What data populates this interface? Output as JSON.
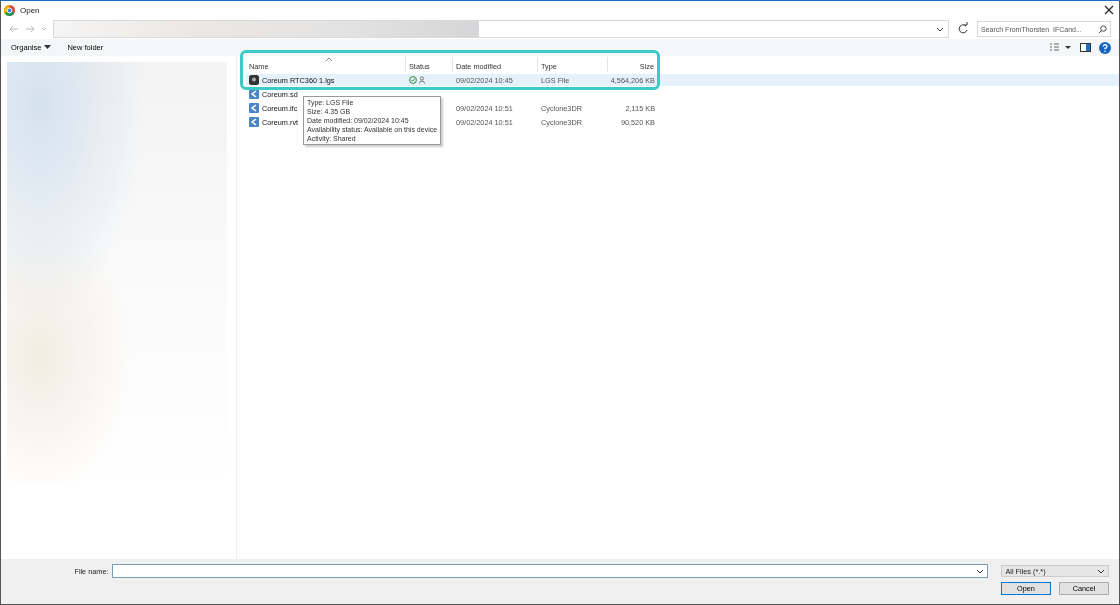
{
  "window": {
    "title": "Open"
  },
  "search": {
    "placeholder": "Search FromThorsten_IFCand..."
  },
  "toolbar": {
    "buttons": [
      "Organise",
      "New folder"
    ]
  },
  "table": {
    "columns": [
      "Name",
      "Status",
      "Date modified",
      "Type",
      "Size"
    ],
    "rows": [
      {
        "kind": "lgs",
        "name": "Coreum RTC360 1.lgs",
        "status": true,
        "date": "09/02/2024 10:45",
        "type": "LGS File",
        "size": "4,564,206 KB",
        "selected": true
      },
      {
        "kind": "cyclone",
        "name": "Coreum.sd",
        "selected": false
      },
      {
        "kind": "cyclone",
        "name": "Coreum.ifc",
        "date": "09/02/2024 10:51",
        "type": "Cyclone3DR",
        "size": "2,115 KB",
        "selected": false
      },
      {
        "kind": "cyclone",
        "name": "Coreum.rvt",
        "date": "09/02/2024 10:51",
        "type": "Cyclone3DR",
        "size": "90,520 KB",
        "selected": false
      }
    ]
  },
  "tooltip": [
    "Type: LGS File",
    "Size: 4.35 GB",
    "Date modified: 09/02/2024 10:45",
    "Availability status: Available on this device",
    "Activity: Shared"
  ],
  "file_name": {
    "label": "File name:"
  },
  "filter": {
    "value": "All Files (*.*)"
  },
  "buttons": [
    "Open",
    "Cancel"
  ]
}
